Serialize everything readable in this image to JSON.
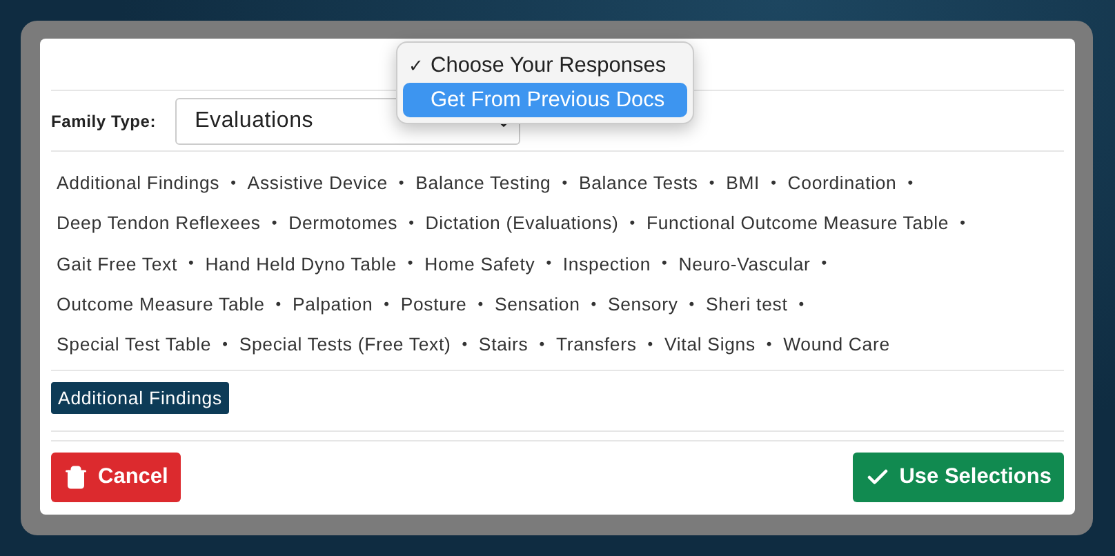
{
  "response_menu": {
    "options": [
      {
        "label": "Choose Your Responses",
        "checked": true,
        "selected": false
      },
      {
        "label": "Get From Previous Docs",
        "checked": false,
        "selected": true
      }
    ],
    "check_mark": "✓"
  },
  "family_type": {
    "label": "Family Type:",
    "value": "Evaluations"
  },
  "separator": "•",
  "item_rows": [
    [
      "Additional Findings",
      "Assistive Device",
      "Balance Testing",
      "Balance Tests",
      "BMI",
      "Coordination"
    ],
    [
      "Deep Tendon Reflexees",
      "Dermotomes",
      "Dictation (Evaluations)",
      "Functional Outcome Measure Table"
    ],
    [
      "Gait Free Text",
      "Hand Held Dyno Table",
      "Home Safety ",
      "Inspection",
      "Neuro-Vascular"
    ],
    [
      "Outcome Measure Table",
      "Palpation",
      "Posture",
      "Sensation",
      "Sensory",
      "Sheri test"
    ],
    [
      "Special Test Table",
      "Special Tests (Free Text)",
      "Stairs",
      "Transfers",
      "Vital Signs",
      "Wound Care"
    ]
  ],
  "selected_items": [
    "Additional Findings"
  ],
  "buttons": {
    "cancel": "Cancel",
    "use": "Use Selections"
  }
}
